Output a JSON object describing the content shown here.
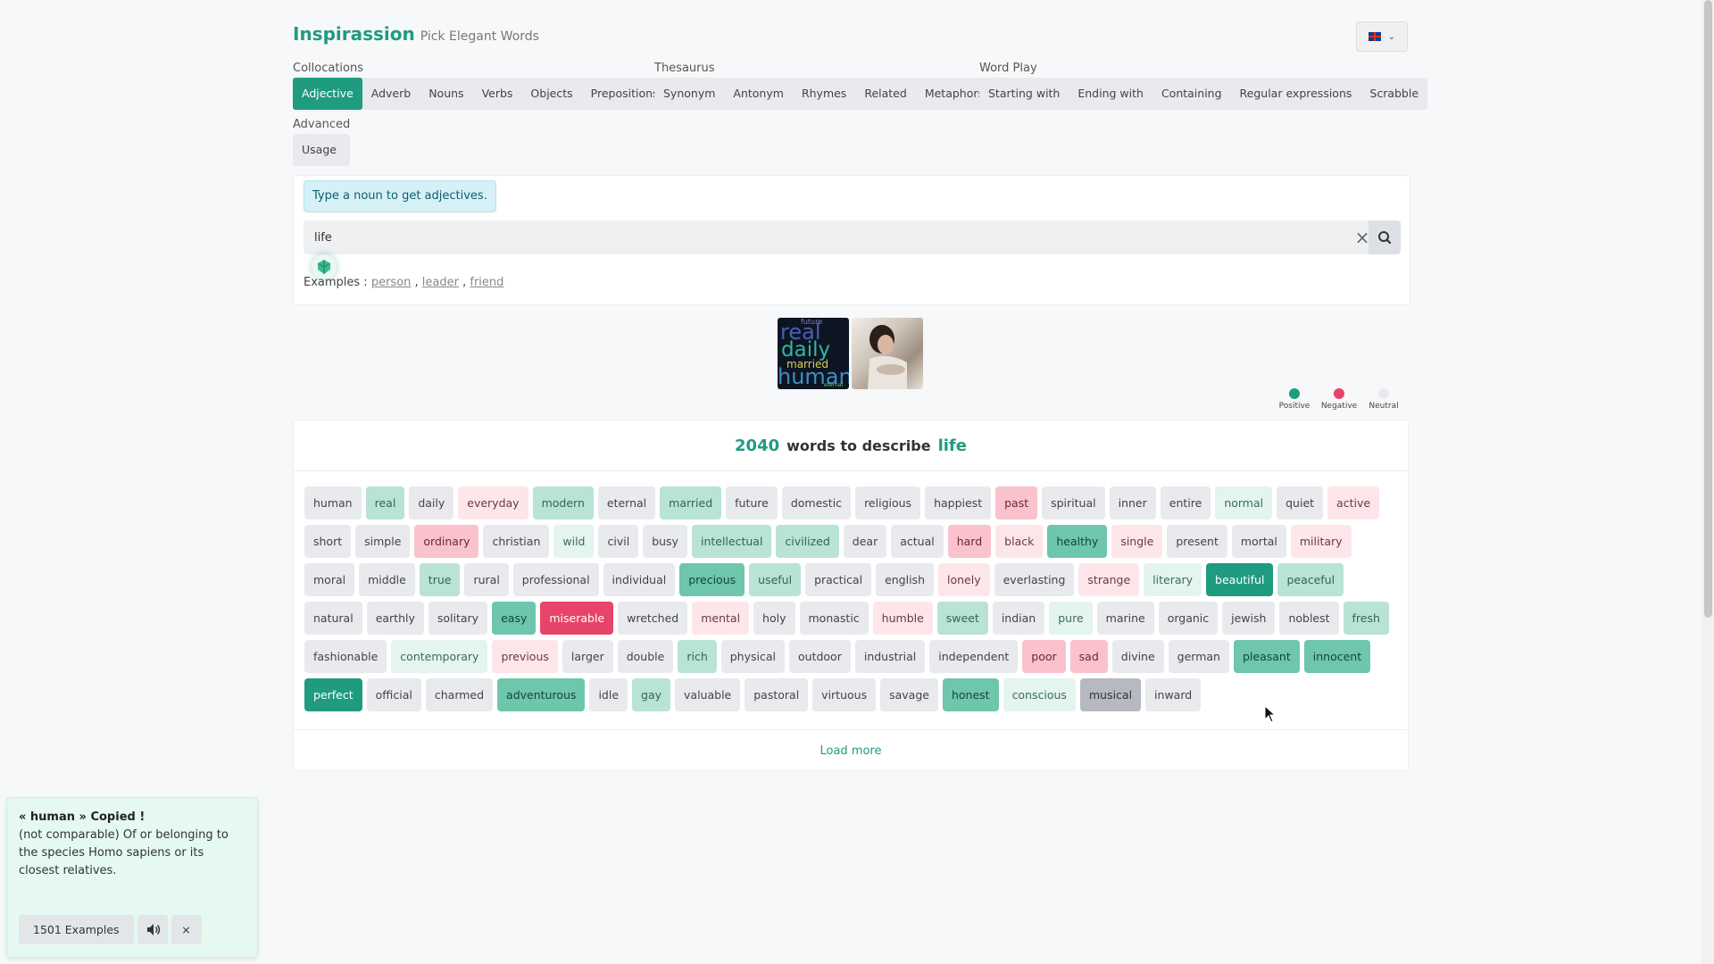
{
  "brand": {
    "name": "Inspirassion",
    "tagline": "Pick Elegant Words"
  },
  "lang": {
    "flag": "uk-flag-icon"
  },
  "nav": {
    "collocations": {
      "label": "Collocations",
      "items": [
        "Adjective",
        "Adverb",
        "Nouns",
        "Verbs",
        "Objects",
        "Prepositions"
      ],
      "active": "Adjective"
    },
    "thesaurus": {
      "label": "Thesaurus",
      "items": [
        "Synonym",
        "Antonym",
        "Rhymes",
        "Related",
        "Metaphors"
      ]
    },
    "wordplay": {
      "label": "Word Play",
      "items": [
        "Starting with",
        "Ending with",
        "Containing",
        "Regular expressions",
        "Scrabble"
      ]
    },
    "advanced": {
      "label": "Advanced",
      "items": [
        "Usage"
      ]
    }
  },
  "search": {
    "hint": "Type a noun to get adjectives.",
    "value": "life",
    "examples_label": "Examples :",
    "examples": [
      "person",
      "leader",
      "friend"
    ]
  },
  "wordcloud": [
    "future",
    "real",
    "daily",
    "married",
    "human",
    "eternal"
  ],
  "legend": [
    {
      "label": "Positive",
      "color": "#1f9b80"
    },
    {
      "label": "Negative",
      "color": "#e84368"
    },
    {
      "label": "Neutral",
      "color": "#e8eaed"
    }
  ],
  "results": {
    "count": "2040",
    "text": "words to describe",
    "word": "life",
    "load_more": "Load more",
    "words": [
      {
        "w": "human",
        "s": "n"
      },
      {
        "w": "real",
        "s": "p2"
      },
      {
        "w": "daily",
        "s": "n"
      },
      {
        "w": "everyday",
        "s": "g1"
      },
      {
        "w": "modern",
        "s": "p2"
      },
      {
        "w": "eternal",
        "s": "n"
      },
      {
        "w": "married",
        "s": "p2"
      },
      {
        "w": "future",
        "s": "n"
      },
      {
        "w": "domestic",
        "s": "n"
      },
      {
        "w": "religious",
        "s": "n"
      },
      {
        "w": "happiest",
        "s": "n"
      },
      {
        "w": "past",
        "s": "g2"
      },
      {
        "w": "spiritual",
        "s": "n"
      },
      {
        "w": "inner",
        "s": "n"
      },
      {
        "w": "entire",
        "s": "n"
      },
      {
        "w": "normal",
        "s": "p1"
      },
      {
        "w": "quiet",
        "s": "n"
      },
      {
        "w": "active",
        "s": "g1"
      },
      {
        "w": "short",
        "s": "n"
      },
      {
        "w": "simple",
        "s": "n"
      },
      {
        "w": "ordinary",
        "s": "g2"
      },
      {
        "w": "christian",
        "s": "n"
      },
      {
        "w": "wild",
        "s": "p1"
      },
      {
        "w": "civil",
        "s": "n"
      },
      {
        "w": "busy",
        "s": "n"
      },
      {
        "w": "intellectual",
        "s": "p2"
      },
      {
        "w": "civilized",
        "s": "p2"
      },
      {
        "w": "dear",
        "s": "n"
      },
      {
        "w": "actual",
        "s": "n"
      },
      {
        "w": "hard",
        "s": "g2"
      },
      {
        "w": "black",
        "s": "g1"
      },
      {
        "w": "healthy",
        "s": "p3"
      },
      {
        "w": "single",
        "s": "g1"
      },
      {
        "w": "present",
        "s": "n"
      },
      {
        "w": "mortal",
        "s": "n"
      },
      {
        "w": "military",
        "s": "g1"
      },
      {
        "w": "moral",
        "s": "n"
      },
      {
        "w": "middle",
        "s": "n"
      },
      {
        "w": "true",
        "s": "p2"
      },
      {
        "w": "rural",
        "s": "n"
      },
      {
        "w": "professional",
        "s": "n"
      },
      {
        "w": "individual",
        "s": "n"
      },
      {
        "w": "precious",
        "s": "p3"
      },
      {
        "w": "useful",
        "s": "p2"
      },
      {
        "w": "practical",
        "s": "n"
      },
      {
        "w": "english",
        "s": "n"
      },
      {
        "w": "lonely",
        "s": "g1"
      },
      {
        "w": "everlasting",
        "s": "n"
      },
      {
        "w": "strange",
        "s": "g1"
      },
      {
        "w": "literary",
        "s": "p1"
      },
      {
        "w": "beautiful",
        "s": "p4"
      },
      {
        "w": "peaceful",
        "s": "p2"
      },
      {
        "w": "natural",
        "s": "n"
      },
      {
        "w": "earthly",
        "s": "n"
      },
      {
        "w": "solitary",
        "s": "n"
      },
      {
        "w": "easy",
        "s": "p3"
      },
      {
        "w": "miserable",
        "s": "g3"
      },
      {
        "w": "wretched",
        "s": "n"
      },
      {
        "w": "mental",
        "s": "g1"
      },
      {
        "w": "holy",
        "s": "n"
      },
      {
        "w": "monastic",
        "s": "n"
      },
      {
        "w": "humble",
        "s": "g1"
      },
      {
        "w": "sweet",
        "s": "p2"
      },
      {
        "w": "indian",
        "s": "n"
      },
      {
        "w": "pure",
        "s": "p1"
      },
      {
        "w": "marine",
        "s": "n"
      },
      {
        "w": "organic",
        "s": "n"
      },
      {
        "w": "jewish",
        "s": "n"
      },
      {
        "w": "noblest",
        "s": "n"
      },
      {
        "w": "fresh",
        "s": "p2"
      },
      {
        "w": "fashionable",
        "s": "n"
      },
      {
        "w": "contemporary",
        "s": "p1"
      },
      {
        "w": "previous",
        "s": "g1"
      },
      {
        "w": "larger",
        "s": "n"
      },
      {
        "w": "double",
        "s": "n"
      },
      {
        "w": "rich",
        "s": "p2"
      },
      {
        "w": "physical",
        "s": "n"
      },
      {
        "w": "outdoor",
        "s": "n"
      },
      {
        "w": "industrial",
        "s": "n"
      },
      {
        "w": "independent",
        "s": "n"
      },
      {
        "w": "poor",
        "s": "g2"
      },
      {
        "w": "sad",
        "s": "g2"
      },
      {
        "w": "divine",
        "s": "n"
      },
      {
        "w": "german",
        "s": "n"
      },
      {
        "w": "pleasant",
        "s": "p3"
      },
      {
        "w": "innocent",
        "s": "p3"
      },
      {
        "w": "perfect",
        "s": "p4"
      },
      {
        "w": "official",
        "s": "n"
      },
      {
        "w": "charmed",
        "s": "n"
      },
      {
        "w": "adventurous",
        "s": "p3"
      },
      {
        "w": "idle",
        "s": "n"
      },
      {
        "w": "gay",
        "s": "p2"
      },
      {
        "w": "valuable",
        "s": "n"
      },
      {
        "w": "pastoral",
        "s": "n"
      },
      {
        "w": "virtuous",
        "s": "n"
      },
      {
        "w": "savage",
        "s": "n"
      },
      {
        "w": "honest",
        "s": "p3"
      },
      {
        "w": "conscious",
        "s": "p1"
      },
      {
        "w": "musical",
        "s": "hover"
      },
      {
        "w": "inward",
        "s": "n"
      }
    ]
  },
  "toast": {
    "title": "« human » Copied !",
    "definition": "(not comparable) Of or belonging to the species Homo sapiens or its closest relatives.",
    "examples_btn": "1501 Examples",
    "close": "×"
  }
}
